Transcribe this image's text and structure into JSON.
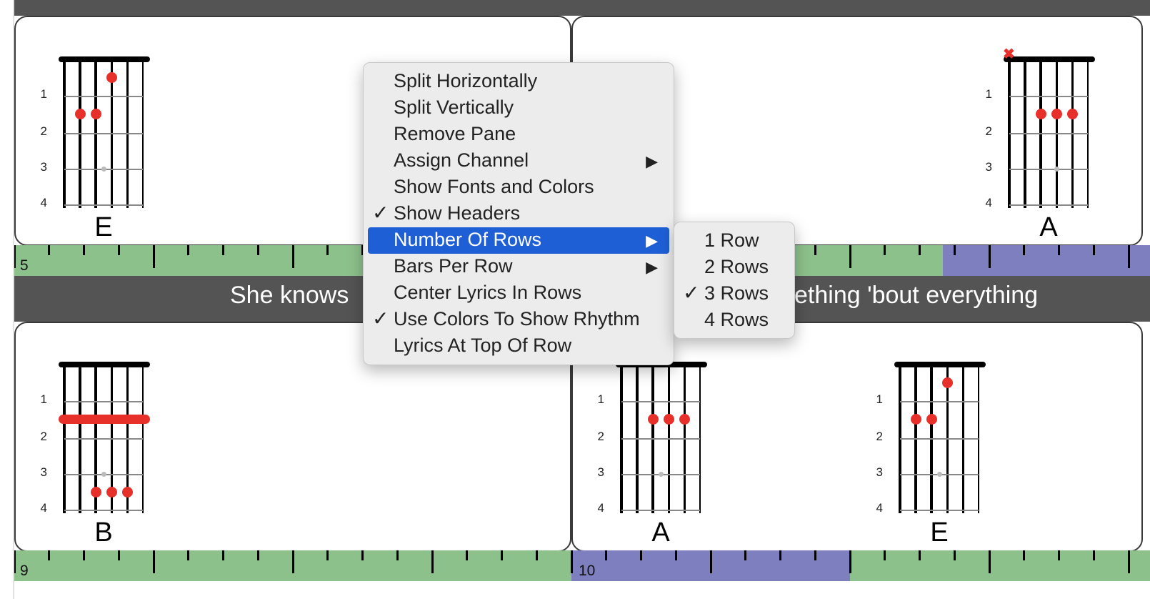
{
  "rows": [
    {
      "bars": [
        {
          "chord": "E",
          "number": null
        },
        {
          "chord": "A",
          "number": null
        }
      ],
      "ruler_start": "5",
      "lyric": {
        "left": "She knows",
        "right": "ething 'bout everything"
      }
    },
    {
      "bars": [
        {
          "chord": "B",
          "number": "9"
        },
        {
          "chord": "A",
          "number": "10"
        },
        {
          "chord": "E",
          "number": null
        }
      ]
    }
  ],
  "fret_numbers": [
    "1",
    "2",
    "3",
    "4"
  ],
  "mute_marker": "✖",
  "context_menu": {
    "items": [
      {
        "label": "Split Horizontally",
        "checked": false,
        "submenu": false
      },
      {
        "label": "Split Vertically",
        "checked": false,
        "submenu": false
      },
      {
        "label": "Remove Pane",
        "checked": false,
        "submenu": false
      },
      {
        "label": "Assign Channel",
        "checked": false,
        "submenu": true
      },
      {
        "label": "Show Fonts and Colors",
        "checked": false,
        "submenu": false
      },
      {
        "label": "Show Headers",
        "checked": true,
        "submenu": false
      },
      {
        "label": "Number Of Rows",
        "checked": false,
        "submenu": true,
        "highlighted": true
      },
      {
        "label": "Bars Per Row",
        "checked": false,
        "submenu": true
      },
      {
        "label": "Center Lyrics In Rows",
        "checked": false,
        "submenu": false
      },
      {
        "label": "Use Colors To Show Rhythm",
        "checked": true,
        "submenu": false
      },
      {
        "label": "Lyrics At Top Of Row",
        "checked": false,
        "submenu": false
      }
    ],
    "check_glyph": "✓",
    "arrow_glyph": "▶"
  },
  "submenu": {
    "items": [
      {
        "label": "1 Row",
        "checked": false
      },
      {
        "label": "2 Rows",
        "checked": false
      },
      {
        "label": "3 Rows",
        "checked": true
      },
      {
        "label": "4 Rows",
        "checked": false
      }
    ]
  },
  "colors": {
    "header_band": "#545454",
    "ruler_green": "#8dc18b",
    "ruler_purple": "#7e7fbf",
    "dot_red": "#e8302a",
    "menu_bg": "#ececec",
    "menu_highlight": "#1f5fd6"
  },
  "icons": {
    "checkmark": "checkmark-icon",
    "submenu_arrow": "chevron-right-icon",
    "mute": "close-icon"
  }
}
